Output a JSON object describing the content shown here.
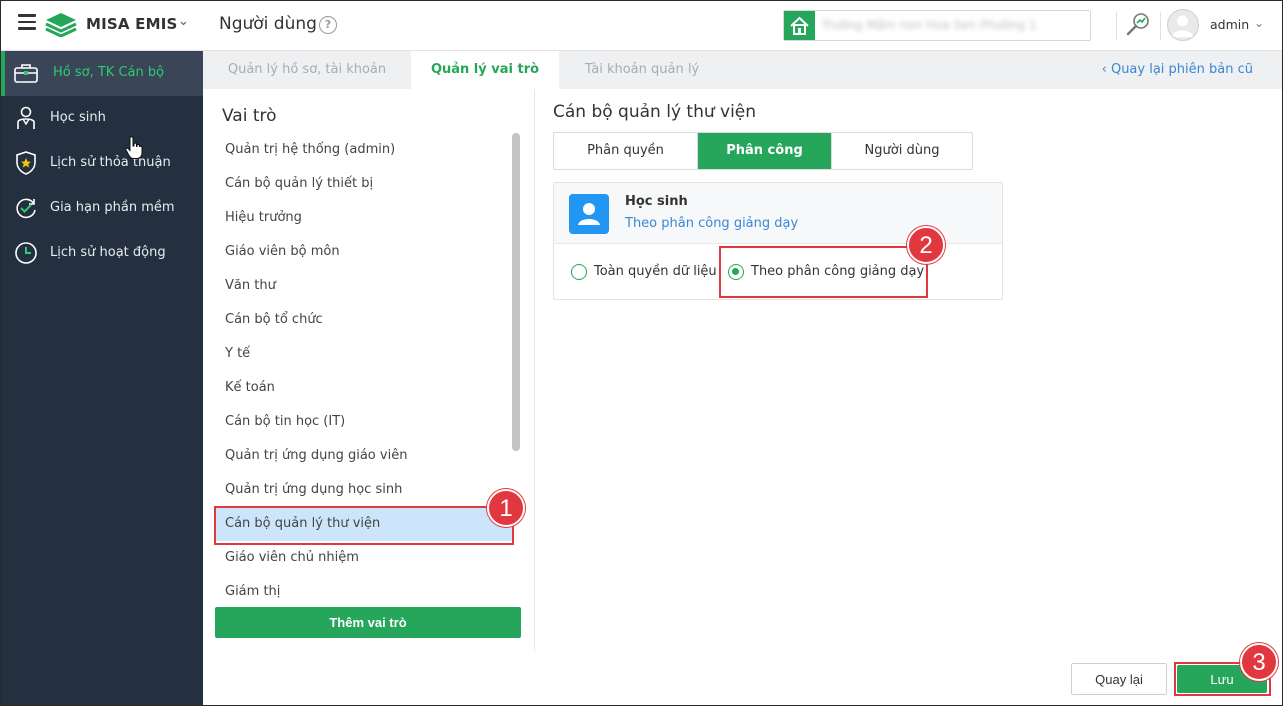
{
  "header": {
    "logo_text": "MISA EMIS",
    "page_title": "Người dùng",
    "help_glyph": "?",
    "school_name": "Trường Mầm non Hoa Sen Phường 1",
    "user_name": "admin",
    "chevron": "⌄"
  },
  "sidebar": {
    "items": [
      {
        "label": "Hồ sơ, TK Cán bộ",
        "icon": "briefcase-icon",
        "active": true
      },
      {
        "label": "Học sinh",
        "icon": "student-icon",
        "active": false
      },
      {
        "label": "Lịch sử thỏa thuận",
        "icon": "shield-star-icon",
        "active": false
      },
      {
        "label": "Gia hạn phần mềm",
        "icon": "renew-icon",
        "active": false
      },
      {
        "label": "Lịch sử hoạt động",
        "icon": "clock-icon",
        "active": false
      }
    ]
  },
  "tabs": {
    "items": [
      {
        "label": "Quản lý hồ sơ, tài khoản",
        "active": false
      },
      {
        "label": "Quản lý vai trò",
        "active": true
      },
      {
        "label": "Tài khoản quản lý",
        "active": false
      }
    ],
    "back_link": "‹ Quay lại phiên bản cũ"
  },
  "roles": {
    "title": "Vai trò",
    "items": [
      "Quản trị hệ thống (admin)",
      "Cán bộ quản lý thiết bị",
      "Hiệu trưởng",
      "Giáo viên bộ môn",
      "Văn thư",
      "Cán bộ tổ chức",
      "Y tế",
      "Kế toán",
      "Cán bộ tin học (IT)",
      "Quản trị ứng dụng giáo viên",
      "Quản trị ứng dụng học sinh",
      "Cán bộ quản lý thư viện",
      "Giáo viên chủ nhiệm",
      "Giám thị"
    ],
    "selected_index": 11,
    "add_button": "Thêm vai trò"
  },
  "content": {
    "title": "Cán bộ quản lý thư viện",
    "subtabs": [
      {
        "label": "Phân quyền",
        "active": false
      },
      {
        "label": "Phân công",
        "active": true
      },
      {
        "label": "Người dùng",
        "active": false
      }
    ],
    "card": {
      "title": "Học sinh",
      "subtitle": "Theo phân công giảng dạy",
      "options": [
        {
          "label": "Toàn quyền dữ liệu",
          "checked": false
        },
        {
          "label": "Theo phân công giảng dạy",
          "checked": true
        }
      ]
    }
  },
  "footer": {
    "back_button": "Quay lại",
    "save_button": "Lưu"
  },
  "annotations": {
    "badges": [
      "1",
      "2",
      "3"
    ]
  },
  "colors": {
    "brand_green": "#26a65b",
    "sidebar_bg": "#24303f",
    "link_blue": "#3a86d6",
    "annotation_red": "#e0383e",
    "selected_row": "#cce5fb"
  }
}
